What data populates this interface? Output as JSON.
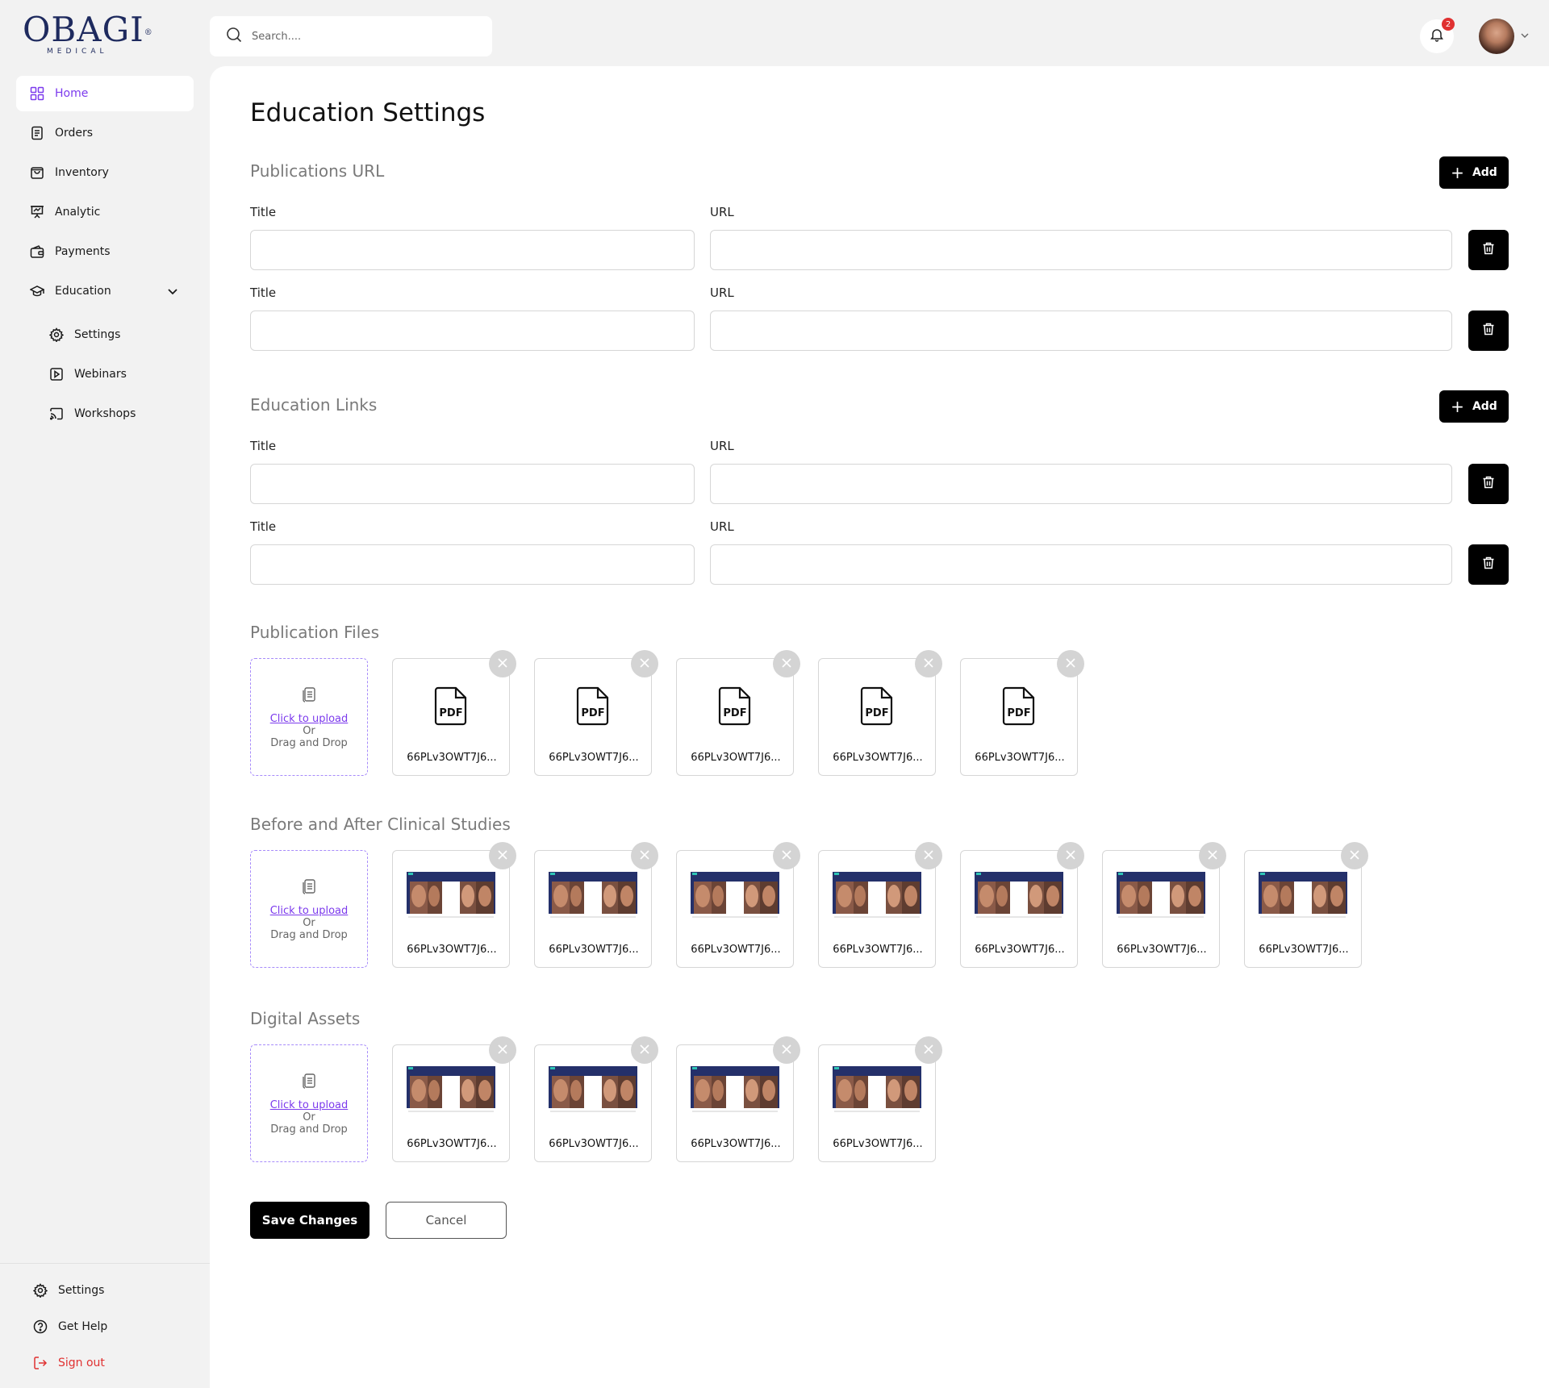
{
  "brand": {
    "name": "OBAGI",
    "reg": "®",
    "sub": "MEDICAL",
    "color": "#1e2a5e"
  },
  "search": {
    "placeholder": "Search...."
  },
  "notifications": {
    "count": "2"
  },
  "sidebar": {
    "items": [
      {
        "label": "Home",
        "icon": "grid-icon",
        "active": true
      },
      {
        "label": "Orders",
        "icon": "document-icon"
      },
      {
        "label": "Inventory",
        "icon": "bag-icon"
      },
      {
        "label": "Analytic",
        "icon": "presentation-chart-icon"
      },
      {
        "label": "Payments",
        "icon": "wallet-icon"
      },
      {
        "label": "Education",
        "icon": "graduation-cap-icon",
        "expanded": true
      }
    ],
    "subitems": [
      {
        "label": "Settings",
        "icon": "gear-icon"
      },
      {
        "label": "Webinars",
        "icon": "play-icon"
      },
      {
        "label": "Workshops",
        "icon": "cast-icon"
      }
    ],
    "bottom": [
      {
        "label": "Settings",
        "icon": "gear-icon"
      },
      {
        "label": "Get Help",
        "icon": "help-circle-icon"
      },
      {
        "label": "Sign out",
        "icon": "sign-out-icon"
      }
    ]
  },
  "page": {
    "title": "Education Settings"
  },
  "publications_url": {
    "title": "Publications URL",
    "add_label": "Add",
    "rows": [
      {
        "title_label": "Title",
        "url_label": "URL",
        "title_value": "",
        "url_value": ""
      },
      {
        "title_label": "Title",
        "url_label": "URL",
        "title_value": "",
        "url_value": ""
      }
    ]
  },
  "education_links": {
    "title": "Education Links",
    "add_label": "Add",
    "rows": [
      {
        "title_label": "Title",
        "url_label": "URL",
        "title_value": "",
        "url_value": ""
      },
      {
        "title_label": "Title",
        "url_label": "URL",
        "title_value": "",
        "url_value": ""
      }
    ]
  },
  "upload": {
    "link": "Click to upload",
    "or": "Or",
    "drag": "Drag and Drop"
  },
  "publication_files": {
    "title": "Publication Files",
    "files": [
      "66PLv3OWT7J6...",
      "66PLv3OWT7J6...",
      "66PLv3OWT7J6...",
      "66PLv3OWT7J6...",
      "66PLv3OWT7J6..."
    ]
  },
  "clinical_studies": {
    "title": "Before and After Clinical Studies",
    "files": [
      "66PLv3OWT7J6...",
      "66PLv3OWT7J6...",
      "66PLv3OWT7J6...",
      "66PLv3OWT7J6...",
      "66PLv3OWT7J6...",
      "66PLv3OWT7J6...",
      "66PLv3OWT7J6..."
    ]
  },
  "digital_assets": {
    "title": "Digital Assets",
    "files": [
      "66PLv3OWT7J6...",
      "66PLv3OWT7J6...",
      "66PLv3OWT7J6...",
      "66PLv3OWT7J6..."
    ]
  },
  "actions": {
    "save": "Save Changes",
    "cancel": "Cancel"
  },
  "colors": {
    "accent": "#7c3aed",
    "danger": "#e03131",
    "primary": "#000000"
  }
}
